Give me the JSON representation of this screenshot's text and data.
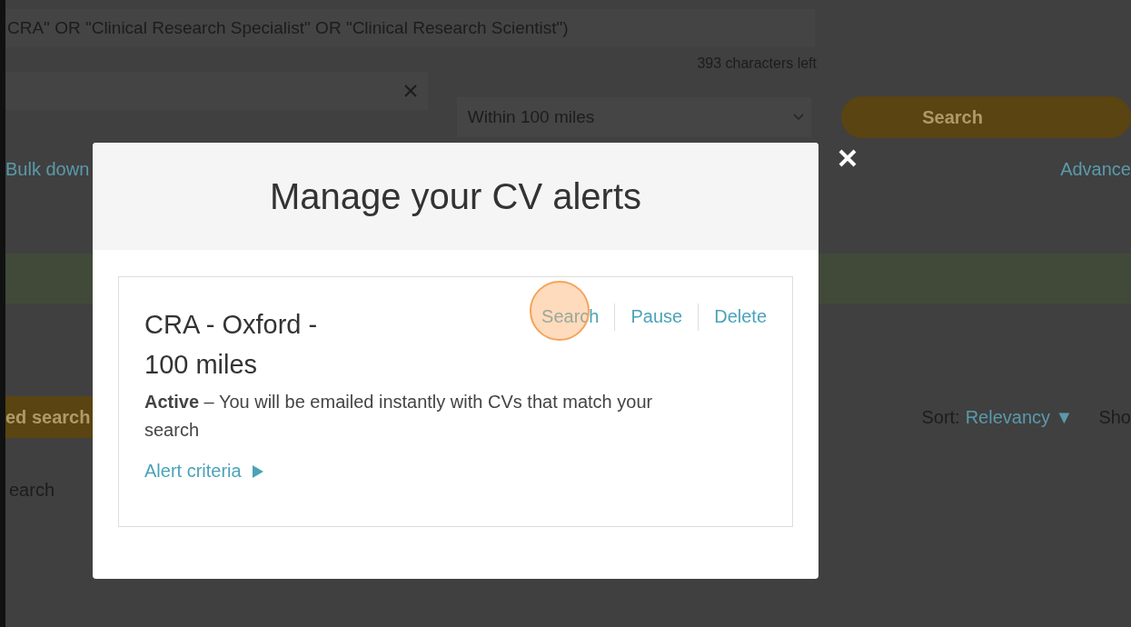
{
  "search_query": {
    "value": "CRA\" OR \"Clinical Research Specialist\" OR \"Clinical Research Scientist\")"
  },
  "characters_left": "393 characters left",
  "distance_select": {
    "value": "Within 100 miles"
  },
  "search_button": "Search",
  "bulk_link": "Bulk down",
  "advanced_link": "Advance",
  "saved_search_button": "ed search",
  "sort": {
    "label": "Sort:",
    "value": "Relevancy ▼"
  },
  "show_label": "Sho",
  "side_link": "earch",
  "modal": {
    "title": "Manage your CV alerts",
    "alerts": [
      {
        "name": "CRA - Oxford - 100 miles",
        "description": "**Active** – You will be emailed instantly with CVs that match your search",
        "actions": [
          "Search",
          "Pause",
          "Delete"
        ],
        "criteria_link": "Alert criteria"
      }
    ]
  }
}
